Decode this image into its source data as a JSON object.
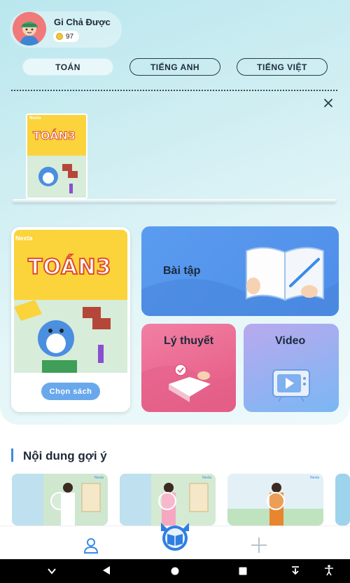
{
  "profile": {
    "name": "Gi Chả Được",
    "coins": "97"
  },
  "tabs": [
    {
      "label": "TOÁN",
      "active": true
    },
    {
      "label": "TIẾNG ANH",
      "active": false
    },
    {
      "label": "TIẾNG VIỆT",
      "active": false
    }
  ],
  "shelf": {
    "book_brand": "Nexta",
    "book_title": "TOÁN3"
  },
  "book": {
    "brand": "Nexta",
    "title": "TOÁN3",
    "choose_label": "Chọn sách"
  },
  "tiles": {
    "exercise": "Bài tập",
    "theory": "Lý thuyết",
    "video": "Video"
  },
  "suggested": {
    "title": "Nội dung gợi ý"
  },
  "thumb_brand": "Nexta",
  "colors": {
    "accent": "#3a8be8",
    "exercise": "#5a9cf0",
    "theory": "#e25780",
    "video": "#9bb0f2",
    "coin": "#f5c23a"
  },
  "icons": [
    "profile-icon",
    "book-home-icon",
    "crosshair-icon",
    "back-icon",
    "home-icon",
    "recents-icon",
    "chevron-down-icon",
    "accessibility-icon",
    "close-icon",
    "play-icon"
  ]
}
